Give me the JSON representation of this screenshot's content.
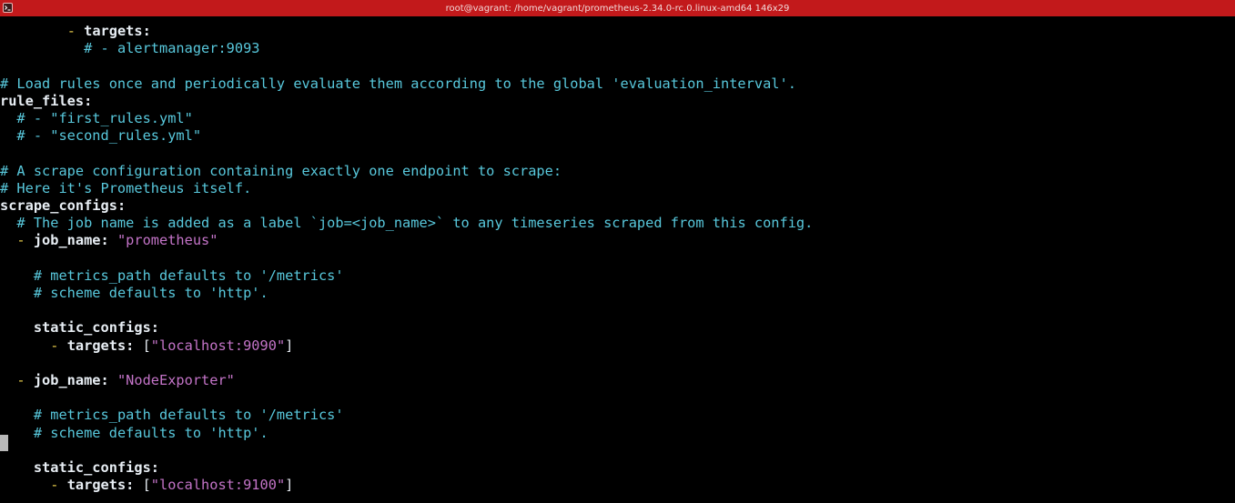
{
  "window": {
    "title": "root@vagrant: /home/vagrant/prometheus-2.34.0-rc.0.linux-amd64 146x29"
  },
  "editor": {
    "lines": [
      {
        "indent": "        ",
        "dash": "- ",
        "key": "targets",
        "sep": ":"
      },
      {
        "indent": "          ",
        "comment": "# - alertmanager:9093"
      },
      {
        "blank": true
      },
      {
        "comment": "# Load rules once and periodically evaluate them according to the global 'evaluation_interval'."
      },
      {
        "key": "rule_files",
        "sep": ":"
      },
      {
        "indent": "  ",
        "comment": "# - \"first_rules.yml\""
      },
      {
        "indent": "  ",
        "comment": "# - \"second_rules.yml\""
      },
      {
        "blank": true
      },
      {
        "comment": "# A scrape configuration containing exactly one endpoint to scrape:"
      },
      {
        "comment": "# Here it's Prometheus itself."
      },
      {
        "key": "scrape_configs",
        "sep": ":"
      },
      {
        "indent": "  ",
        "comment": "# The job name is added as a label `job=<job_name>` to any timeseries scraped from this config."
      },
      {
        "indent": "  ",
        "dash": "- ",
        "key": "job_name",
        "sep": ": ",
        "value": "\"prometheus\""
      },
      {
        "blank": true
      },
      {
        "indent": "    ",
        "comment": "# metrics_path defaults to '/metrics'"
      },
      {
        "indent": "    ",
        "comment": "# scheme defaults to 'http'."
      },
      {
        "blank": true
      },
      {
        "indent": "    ",
        "key": "static_configs",
        "sep": ":"
      },
      {
        "indent": "      ",
        "dash": "- ",
        "key": "targets",
        "sep": ": ",
        "open": "[",
        "value": "\"localhost:9090\"",
        "close": "]"
      },
      {
        "blank": true
      },
      {
        "indent": "  ",
        "dash": "- ",
        "key": "job_name",
        "sep": ": ",
        "value": "\"NodeExporter\""
      },
      {
        "blank": true
      },
      {
        "indent": "    ",
        "comment": "# metrics_path defaults to '/metrics'"
      },
      {
        "indent": "    ",
        "comment": "# scheme defaults to 'http'."
      },
      {
        "blank": true
      },
      {
        "indent": "    ",
        "key": "static_configs",
        "sep": ":"
      },
      {
        "indent": "      ",
        "dash": "- ",
        "key": "targets",
        "sep": ": ",
        "open": "[",
        "value": "\"localhost:9100\"",
        "close": "]"
      }
    ]
  },
  "colors": {
    "titlebar": "#c2191b",
    "background": "#000000",
    "key": "#e8eef4",
    "comment": "#58c8dc",
    "string": "#c474c8",
    "dash": "#e3c94a"
  },
  "icons": {
    "titlebar": "terminal-icon"
  }
}
